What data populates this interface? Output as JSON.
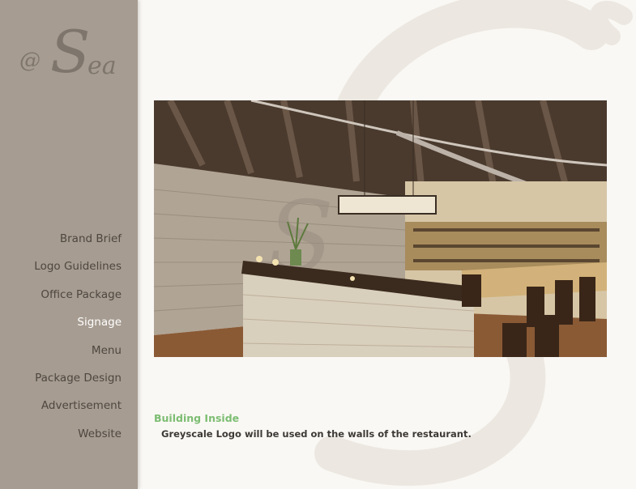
{
  "logo": {
    "at": "@",
    "s": "S",
    "ea": "ea"
  },
  "nav": {
    "items": [
      {
        "label": "Brand Brief",
        "active": false
      },
      {
        "label": "Logo Guidelines",
        "active": false
      },
      {
        "label": "Office Package",
        "active": false
      },
      {
        "label": "Signage",
        "active": true
      },
      {
        "label": "Menu",
        "active": false
      },
      {
        "label": "Package Design",
        "active": false
      },
      {
        "label": "Advertisement",
        "active": false
      },
      {
        "label": "Website",
        "active": false
      }
    ]
  },
  "caption": {
    "title": "Building Inside",
    "text": "Greyscale Logo will be used on the walls of the restaurant."
  },
  "colors": {
    "sidebar": "#a69c91",
    "nav_text": "#4e4740",
    "nav_active": "#ffffff",
    "caption_title": "#7cbd72",
    "background": "#faf8f4"
  }
}
